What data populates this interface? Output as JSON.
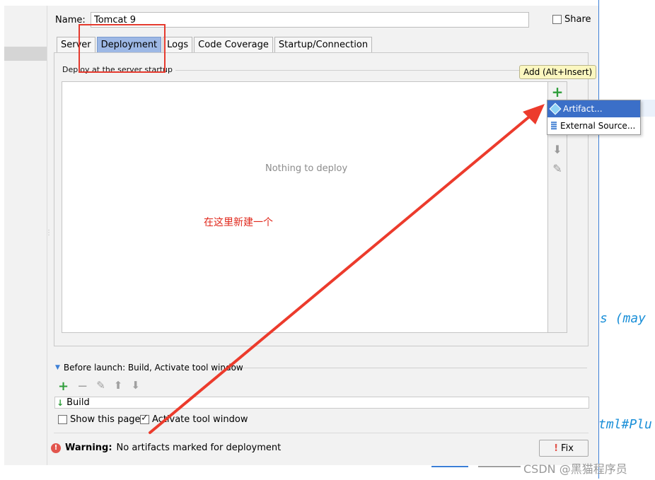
{
  "config": {
    "name_label": "Name:",
    "name_value": "Tomcat 9",
    "share_label": "Share",
    "share_checked": false
  },
  "tabs": [
    {
      "label": "Server",
      "active": false
    },
    {
      "label": "Deployment",
      "active": true
    },
    {
      "label": "Logs",
      "active": false
    },
    {
      "label": "Code Coverage",
      "active": false
    },
    {
      "label": "Startup/Connection",
      "active": false
    }
  ],
  "deploy": {
    "group_label": "Deploy at the server startup",
    "empty_text": "Nothing to deploy",
    "annotation": "在这里新建一个",
    "tooltip": "Add (Alt+Insert)",
    "menu": [
      {
        "label": "Artifact...",
        "icon": "artifact-icon",
        "selected": true
      },
      {
        "label": "External Source...",
        "icon": "external-source-icon",
        "selected": false
      }
    ]
  },
  "background_code": {
    "fragment_1": "s (may",
    "fragment_2": "tml#Plu"
  },
  "before_launch": {
    "label": "Before launch: Build, Activate tool window",
    "items": [
      "Build"
    ]
  },
  "options": {
    "show_page_label": "Show this page",
    "show_page_checked": false,
    "activate_label": "Activate tool window",
    "activate_checked": true
  },
  "warning": {
    "bold": "Warning:",
    "text": "No artifacts marked for deployment"
  },
  "fix_button": "Fix",
  "watermark": "CSDN @黑猫程序员",
  "colors": {
    "active_tab": "#9db8e5",
    "annotation_red": "#e0281c",
    "menu_selected": "#3b6fc8",
    "add_green": "#2e9d3a"
  }
}
